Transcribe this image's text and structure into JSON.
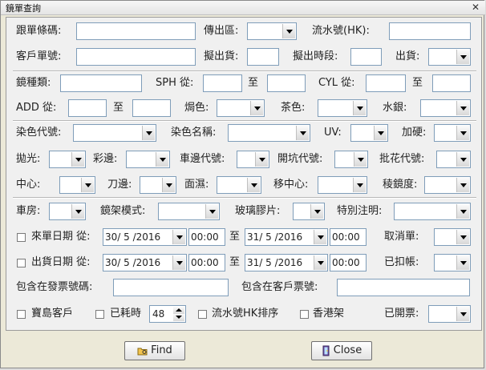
{
  "window": {
    "title": "鏡單查詢",
    "close_glyph": "✕"
  },
  "row1": {
    "order_barcode": "跟單條碼:",
    "issue_area": "傳出區:",
    "serial_hk": "流水號(HK):"
  },
  "row2": {
    "customer_order": "客戶單號:",
    "draft_ship": "擬出貨:",
    "draft_time": "擬出時段:",
    "shipped": "出貨:"
  },
  "row3": {
    "lens_type": "鏡種類:",
    "sph_from": "SPH 從:",
    "to1": "至",
    "cyl_from": "CYL 從:",
    "to2": "至"
  },
  "row4": {
    "add_from": "ADD 從:",
    "to": "至",
    "baked_color": "焗色:",
    "tea_color": "茶色:",
    "mercury": "水銀:"
  },
  "row5": {
    "dye_code": "染色代號:",
    "dye_name": "染色名稱:",
    "uv": "UV:",
    "hard": "加硬:"
  },
  "row6": {
    "polish": "拋光:",
    "color_edge": "彩邊:",
    "car_edge_code": "車邊代號:",
    "groove_code": "開坑代號:",
    "batch_code": "批花代號:"
  },
  "row7": {
    "center": "中心:",
    "knife_edge": "刀邊:",
    "face_wet": "面濕:",
    "move_center": "移中心:",
    "prism": "稜鏡度:"
  },
  "row8": {
    "room": "車房:",
    "frame_mode": "鏡架模式:",
    "glass_film": "玻璃膠片:",
    "special_note": "特別注明:"
  },
  "row9": {
    "incoming_date": "來單日期 從:",
    "date_from": "30/ 5 /2016",
    "time_from": "00:00",
    "to": "至",
    "date_to": "31/ 5 /2016",
    "time_to": "00:00",
    "cancel": "取消單:"
  },
  "row10": {
    "ship_date": "出貨日期 從:",
    "date_from": "30/ 5 /2016",
    "time_from": "00:00",
    "to": "至",
    "date_to": "31/ 5 /2016",
    "time_to": "00:00",
    "deducted": "已扣帳:"
  },
  "row11": {
    "invoice_no": "包含在發票號碼:",
    "customer_ticket": "包含在客戶票號:"
  },
  "row12": {
    "taiwan_customer": "寶島客戶",
    "time_used": "已耗時",
    "time_value": "48",
    "serial_sort": "流水號HK排序",
    "hk_frame": "香港架",
    "invoiced": "已開票:"
  },
  "buttons": {
    "find": "Find",
    "close": "Close"
  }
}
